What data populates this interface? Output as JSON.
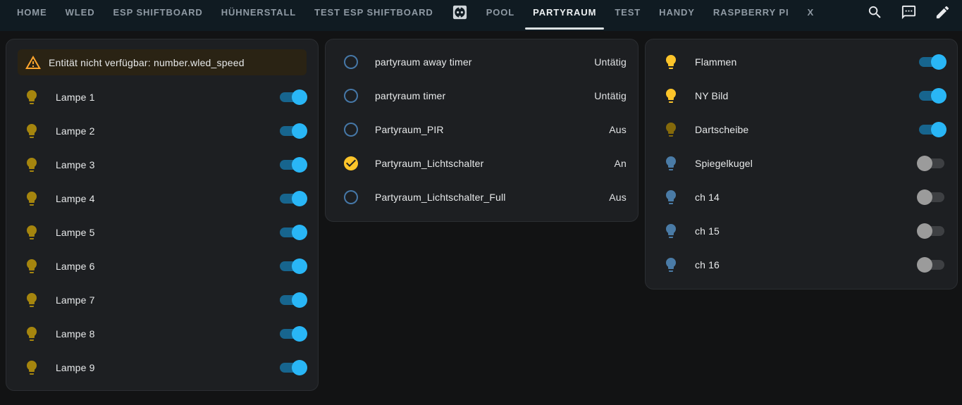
{
  "colors": {
    "page_bg": "#121314",
    "header_bg": "#101b22",
    "card_bg": "#1d1f22",
    "card_border": "#2b2e32",
    "tab_inactive": "#8f9aa4",
    "tab_active": "#edf0f2",
    "header_icon": "#e8eaed",
    "text_primary": "#e7e9ea",
    "state_text": "#e0e2e4",
    "warning_bg": "#2a2314",
    "warning_icon": "#ffa62e",
    "amber": "#fcc42a",
    "bulb_on_dim": "#a5850e",
    "bulb_on_dimmer": "#84690b",
    "bulb_off_blue": "#4a7ba6",
    "sensor_icon_blue": "#4678a8",
    "toggle_on_thumb": "#29b6f6",
    "toggle_on_track": "#17658e",
    "toggle_off_thumb": "#9b9b9b",
    "toggle_off_track": "#3e4043"
  },
  "header": {
    "tabs": [
      {
        "label": "HOME"
      },
      {
        "label": "WLED"
      },
      {
        "label": "ESP SHIFTBOARD"
      },
      {
        "label": "HÜHNERSTALL"
      },
      {
        "label": "TEST ESP SHIFTBOARD"
      },
      {
        "label": "",
        "icon": "power-socket"
      },
      {
        "label": "POOL"
      },
      {
        "label": "PARTYRAUM",
        "active": true
      },
      {
        "label": "TEST"
      },
      {
        "label": "HANDY"
      },
      {
        "label": "RASPBERRY PI"
      },
      {
        "label": "X"
      }
    ],
    "actions": [
      {
        "name": "search",
        "icon": "magnify"
      },
      {
        "name": "assist",
        "icon": "message"
      },
      {
        "name": "edit",
        "icon": "pencil"
      }
    ]
  },
  "cards": {
    "left": {
      "warning": {
        "icon": "alert",
        "text": "Entität nicht verfügbar: number.wled_speed"
      },
      "rows": [
        {
          "name": "Lampe 1",
          "icon": "lightbulb",
          "icon_color": "#a5850e",
          "toggle": "on"
        },
        {
          "name": "Lampe 2",
          "icon": "lightbulb",
          "icon_color": "#a5850e",
          "toggle": "on"
        },
        {
          "name": "Lampe 3",
          "icon": "lightbulb",
          "icon_color": "#a5850e",
          "toggle": "on"
        },
        {
          "name": "Lampe 4",
          "icon": "lightbulb",
          "icon_color": "#a5850e",
          "toggle": "on"
        },
        {
          "name": "Lampe 5",
          "icon": "lightbulb",
          "icon_color": "#a5850e",
          "toggle": "on"
        },
        {
          "name": "Lampe 6",
          "icon": "lightbulb",
          "icon_color": "#a5850e",
          "toggle": "on"
        },
        {
          "name": "Lampe 7",
          "icon": "lightbulb",
          "icon_color": "#a5850e",
          "toggle": "on"
        },
        {
          "name": "Lampe 8",
          "icon": "lightbulb",
          "icon_color": "#a5850e",
          "toggle": "on"
        },
        {
          "name": "Lampe 9",
          "icon": "lightbulb",
          "icon_color": "#a5850e",
          "toggle": "on"
        }
      ]
    },
    "middle": {
      "rows": [
        {
          "name": "partyraum away timer",
          "icon": "circle-outline",
          "icon_color": "#4678a8",
          "state": "Untätig"
        },
        {
          "name": "partyraum timer",
          "icon": "circle-outline",
          "icon_color": "#4678a8",
          "state": "Untätig"
        },
        {
          "name": "Partyraum_PIR",
          "icon": "circle-outline",
          "icon_color": "#4678a8",
          "state": "Aus"
        },
        {
          "name": "Partyraum_Lichtschalter",
          "icon": "check-circle",
          "icon_color": "#fcc42a",
          "state": "An"
        },
        {
          "name": "Partyraum_Lichtschalter_Full",
          "icon": "circle-outline",
          "icon_color": "#4678a8",
          "state": "Aus"
        }
      ]
    },
    "right": {
      "rows": [
        {
          "name": "Flammen",
          "icon": "lightbulb",
          "icon_color": "#fcc42a",
          "toggle": "on"
        },
        {
          "name": "NY Bild",
          "icon": "lightbulb",
          "icon_color": "#fcc42a",
          "toggle": "on"
        },
        {
          "name": "Dartscheibe",
          "icon": "lightbulb",
          "icon_color": "#84690b",
          "toggle": "on"
        },
        {
          "name": "Spiegelkugel",
          "icon": "lightbulb",
          "icon_color": "#4a7ba6",
          "toggle": "off"
        },
        {
          "name": "ch 14",
          "icon": "lightbulb",
          "icon_color": "#4a7ba6",
          "toggle": "off"
        },
        {
          "name": "ch 15",
          "icon": "lightbulb",
          "icon_color": "#4a7ba6",
          "toggle": "off"
        },
        {
          "name": "ch 16",
          "icon": "lightbulb",
          "icon_color": "#4a7ba6",
          "toggle": "off"
        }
      ]
    }
  }
}
